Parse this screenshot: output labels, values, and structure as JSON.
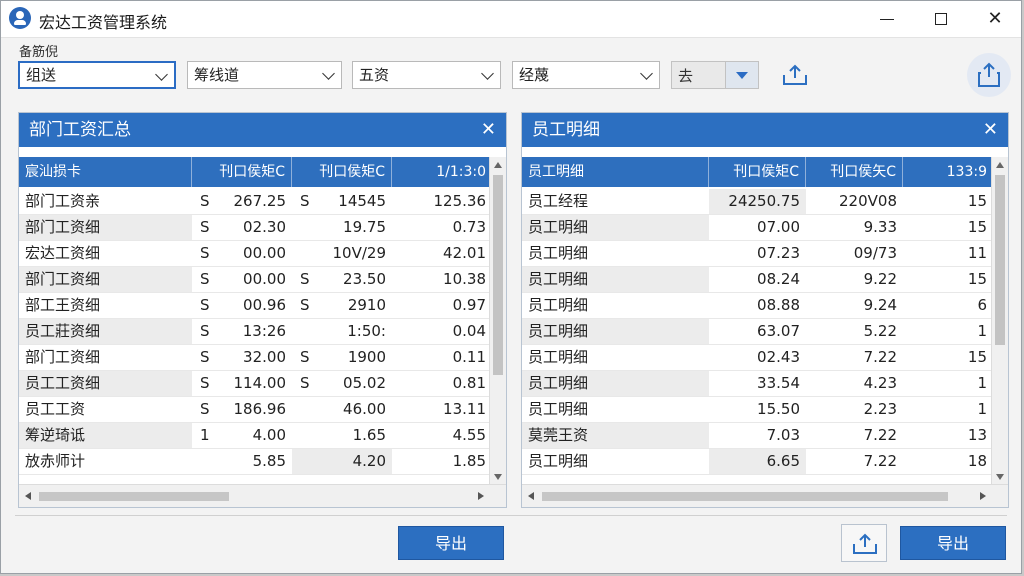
{
  "window": {
    "title": "宏达工资管理系统"
  },
  "filters": {
    "label": "备筋倪",
    "selects": [
      "组送",
      "筹线道",
      "五资",
      "经蔑"
    ],
    "small_combo": "去"
  },
  "left_panel": {
    "title": "部门工资汇总",
    "headers": [
      "宸汕损卡",
      "刊口侯矩C",
      "刊口侯矩C",
      "1/1:3:0"
    ],
    "rows": [
      [
        "部门工资亲",
        "S",
        "267.25",
        "S",
        "14545",
        "125.36"
      ],
      [
        "部门工资细",
        "S",
        "02.30",
        "",
        "19.75",
        "0.73"
      ],
      [
        "宏达工资细",
        "S",
        "00.00",
        "",
        "10V/29",
        "42.01"
      ],
      [
        "部门工资细",
        "S",
        "00.00",
        "S",
        "23.50",
        "10.38"
      ],
      [
        "部工王资细",
        "S",
        "00.96",
        "S",
        "2910",
        "0.97"
      ],
      [
        "员工莊资细",
        "S",
        "13:26",
        "",
        "1:50:",
        "0.04"
      ],
      [
        "部门工资细",
        "S",
        "32.00",
        "S",
        "1900",
        "0.11"
      ],
      [
        "员工工资细",
        "S",
        "114.00",
        "S",
        "05.02",
        "0.81"
      ],
      [
        "员工工资",
        "S",
        "186.96",
        "",
        "46.00",
        "13.11"
      ],
      [
        "筹逆琦诋",
        "1",
        "4.00",
        "",
        "1.65",
        "4.55"
      ],
      [
        "放赤师计",
        "",
        "5.85",
        "",
        "4.20",
        "1.85"
      ]
    ]
  },
  "right_panel": {
    "title": "员工明细",
    "headers": [
      "员工明细",
      "刊口侯矩C",
      "刊口侯矢C",
      "133:9"
    ],
    "rows": [
      [
        "员工经程",
        "24250.75",
        "220V08",
        "15"
      ],
      [
        "员工明细",
        "07.00",
        "9.33",
        "15"
      ],
      [
        "员工明细",
        "07.23",
        "09/73",
        "11"
      ],
      [
        "员工明细",
        "08.24",
        "9.22",
        "15"
      ],
      [
        "员工明细",
        "08.88",
        "9.24",
        "6"
      ],
      [
        "员工明细",
        "63.07",
        "5.22",
        "1"
      ],
      [
        "员工明细",
        "02.43",
        "7.22",
        "15"
      ],
      [
        "员工明细",
        "33.54",
        "4.23",
        "1"
      ],
      [
        "员工明细",
        "15.50",
        "2.23",
        "1"
      ],
      [
        "莫莞王资",
        "7.03",
        "7.22",
        "13"
      ],
      [
        "员工明细",
        "6.65",
        "7.22",
        "18"
      ]
    ]
  },
  "bottom": {
    "export_left": "导出",
    "export_right": "导出"
  },
  "colors": {
    "accent": "#2c6fc1"
  },
  "icons": [
    "app-logo-icon",
    "upload-tray-icon",
    "share-icon",
    "close-icon",
    "chevron-down-icon"
  ]
}
